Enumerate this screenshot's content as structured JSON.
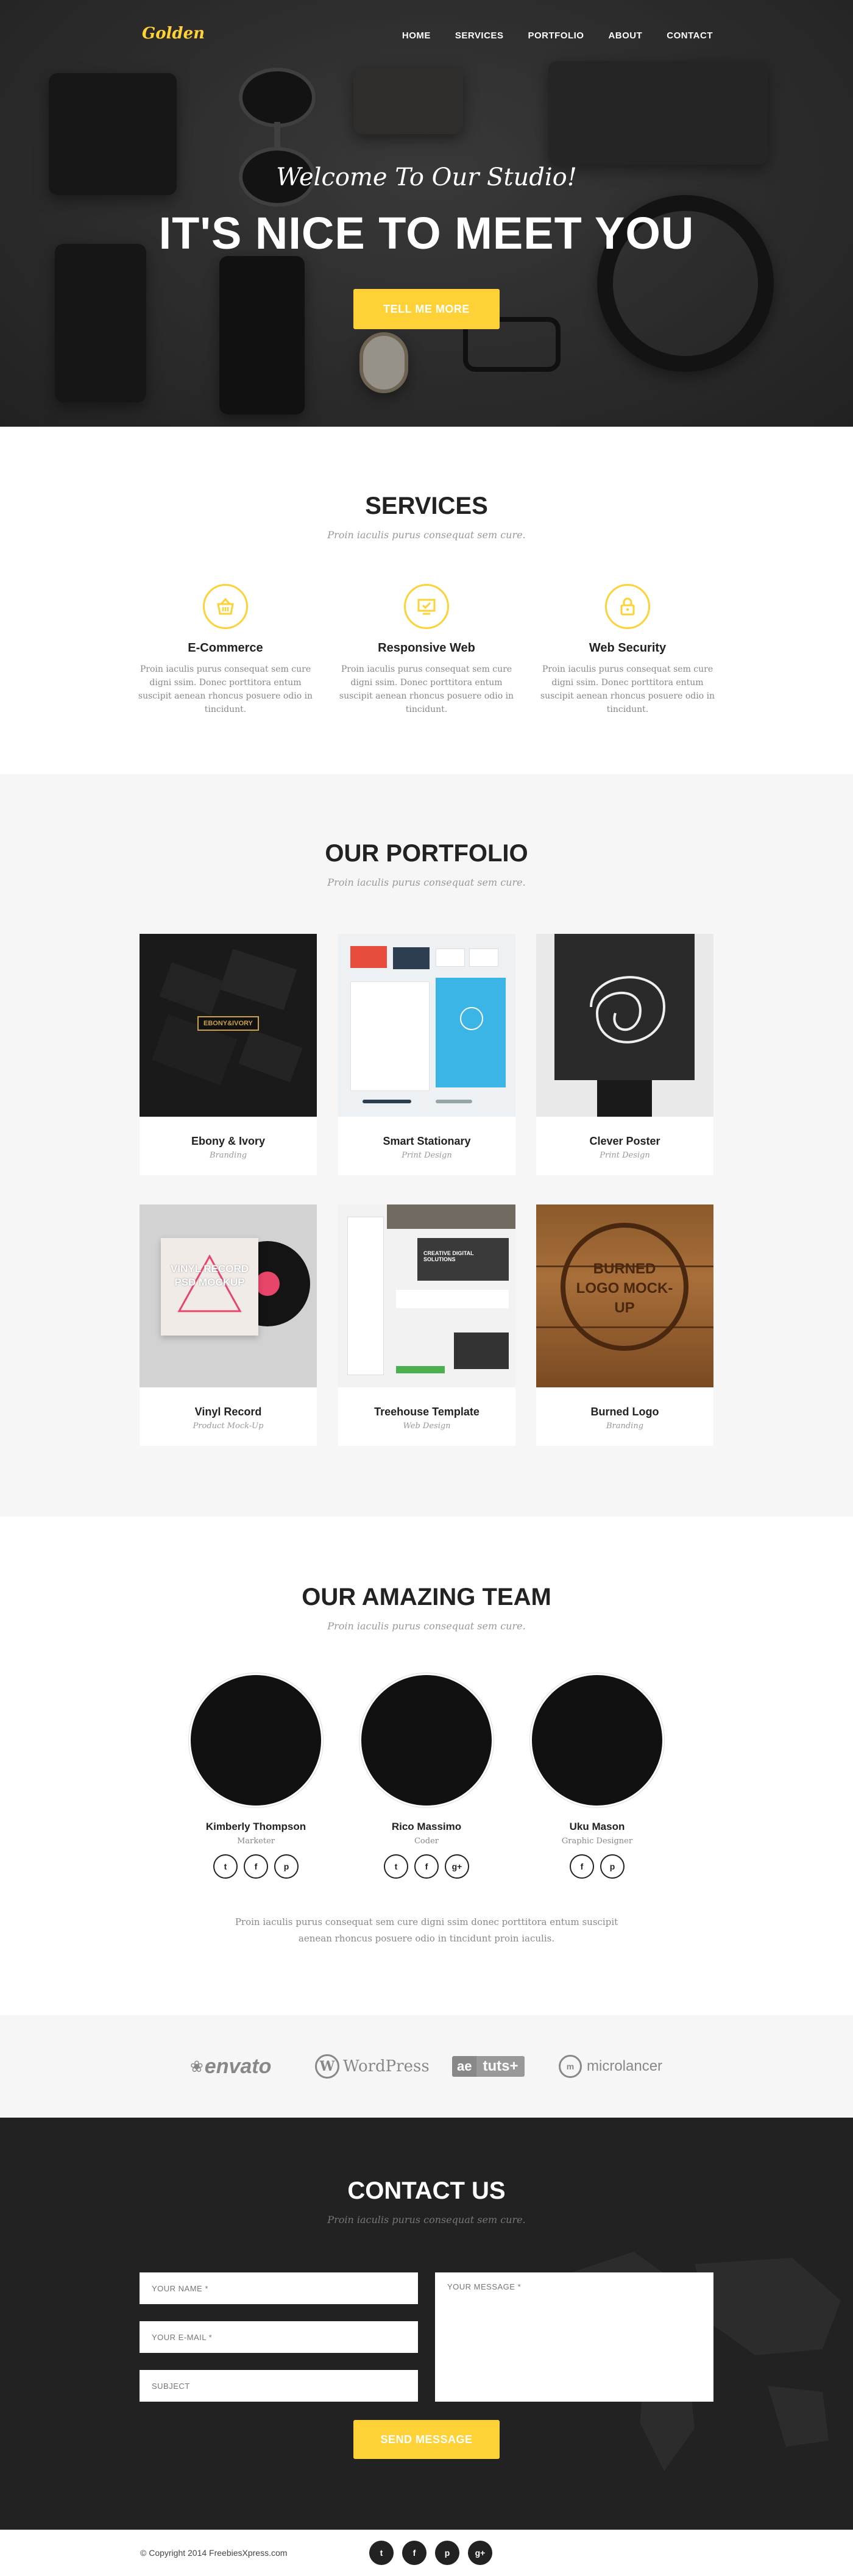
{
  "brand": {
    "logo": "Golden",
    "accent_color": "#fed136"
  },
  "nav": {
    "items": [
      "HOME",
      "SERVICES",
      "PORTFOLIO",
      "ABOUT",
      "CONTACT"
    ]
  },
  "hero": {
    "subtitle": "Welcome To Our Studio!",
    "title": "IT'S NICE TO MEET YOU",
    "button": "TELL ME MORE"
  },
  "services": {
    "title": "SERVICES",
    "subtitle": "Proin iaculis purus consequat sem cure.",
    "items": [
      {
        "icon": "shopping-basket-icon",
        "title": "E-Commerce",
        "text": "Proin iaculis purus consequat sem cure digni ssim. Donec porttitora entum suscipit aenean rhoncus posuere odio in tincidunt."
      },
      {
        "icon": "responsive-screen-icon",
        "title": "Responsive Web",
        "text": "Proin iaculis purus consequat sem cure digni ssim. Donec porttitora entum suscipit aenean rhoncus posuere odio in tincidunt."
      },
      {
        "icon": "lock-icon",
        "title": "Web Security",
        "text": "Proin iaculis purus consequat sem cure digni ssim. Donec porttitora entum suscipit aenean rhoncus posuere odio in tincidunt."
      }
    ]
  },
  "portfolio": {
    "title": "OUR PORTFOLIO",
    "subtitle": "Proin iaculis purus consequat sem cure.",
    "items": [
      {
        "title": "Ebony & Ivory",
        "category": "Branding",
        "image_text": "EBONY&IVORY"
      },
      {
        "title": "Smart Stationary",
        "category": "Print Design"
      },
      {
        "title": "Clever Poster",
        "category": "Print Design"
      },
      {
        "title": "Vinyl Record",
        "category": "Product Mock-Up",
        "image_text": "VINYL RECORD PSD MOCKUP"
      },
      {
        "title": "Treehouse Template",
        "category": "Web Design",
        "image_text": "CREATIVE DIGITAL SOLUTIONS"
      },
      {
        "title": "Burned Logo",
        "category": "Branding",
        "image_text": "BURNED LOGO MOCK-UP"
      }
    ]
  },
  "team": {
    "title": "OUR AMAZING TEAM",
    "subtitle": "Proin iaculis purus consequat sem cure.",
    "members": [
      {
        "name": "Kimberly Thompson",
        "role": "Marketer",
        "socials": [
          "twitter",
          "facebook",
          "pinterest"
        ]
      },
      {
        "name": "Rico Massimo",
        "role": "Coder",
        "socials": [
          "twitter",
          "facebook",
          "google-plus"
        ]
      },
      {
        "name": "Uku Mason",
        "role": "Graphic Designer",
        "socials": [
          "facebook",
          "pinterest"
        ]
      }
    ],
    "text": "Proin iaculis purus consequat sem cure  digni ssim donec porttitora entum suscipit aenean rhoncus posuere odio in tincidunt proin iaculis."
  },
  "clients": [
    "envato",
    "WordPress",
    "tuts+",
    "microlancer"
  ],
  "contact": {
    "title": "CONTACT US",
    "subtitle": "Proin iaculis purus consequat sem cure.",
    "name_placeholder": "YOUR NAME *",
    "email_placeholder": "YOUR E-MAIL *",
    "subject_placeholder": "SUBJECT",
    "message_placeholder": "YOUR MESSAGE *",
    "button": "SEND MESSAGE"
  },
  "footer": {
    "copyright": "© Copyright 2014 FreebiesXpress.com"
  }
}
